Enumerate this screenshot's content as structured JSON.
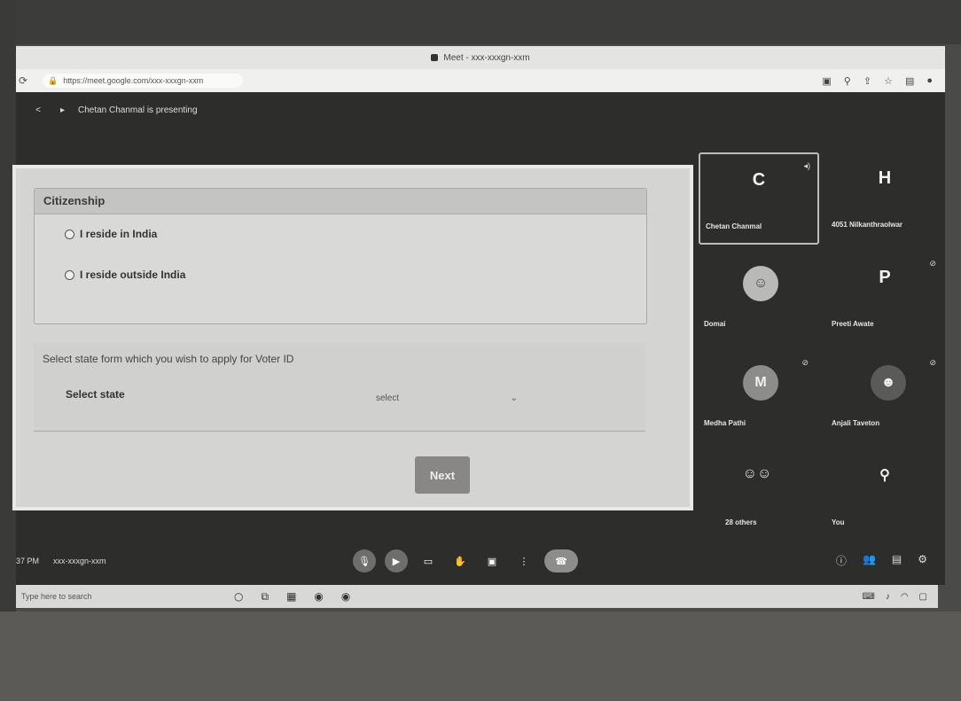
{
  "browser": {
    "window_title": "Meet - xxx-xxxgn-xxm",
    "url": "https://meet.google.com/xxx-xxxgn-xxm"
  },
  "meet": {
    "presenting_text": "Chetan Chanmal is presenting",
    "shared_form": {
      "citizenship_title": "Citizenship",
      "option_india": "I reside in India",
      "option_outside": "I reside outside India",
      "state_prompt": "Select state form which you wish to apply for Voter ID",
      "state_label": "Select state",
      "state_select_value": "select",
      "next_label": "Next"
    },
    "participants": [
      {
        "name": "Chetan Chanmal",
        "initial": "C"
      },
      {
        "name": "4051 NilkanthraoIwar",
        "initial": "H"
      },
      {
        "name": "Domai",
        "initial": ""
      },
      {
        "name": "Preeti Awate",
        "initial": "P"
      },
      {
        "name": "Medha Pathi",
        "initial": "M"
      },
      {
        "name": "Anjali Taveton",
        "initial": ""
      },
      {
        "name": "28 others",
        "initial": ""
      },
      {
        "name": "You",
        "initial": ""
      }
    ],
    "controls": {
      "time": "37 PM",
      "meeting_code": "xxx-xxxgn-xxm"
    }
  },
  "taskbar": {
    "search_placeholder": "Type here to search"
  },
  "icons": {
    "mic": "mic-icon",
    "camera": "camera-icon",
    "captions": "captions-icon",
    "hand": "raise-hand-icon",
    "present": "present-icon",
    "more": "more-icon",
    "end_call": "end-call-icon",
    "info": "info-icon",
    "people": "people-icon",
    "chat": "chat-icon",
    "activities": "activities-icon"
  }
}
